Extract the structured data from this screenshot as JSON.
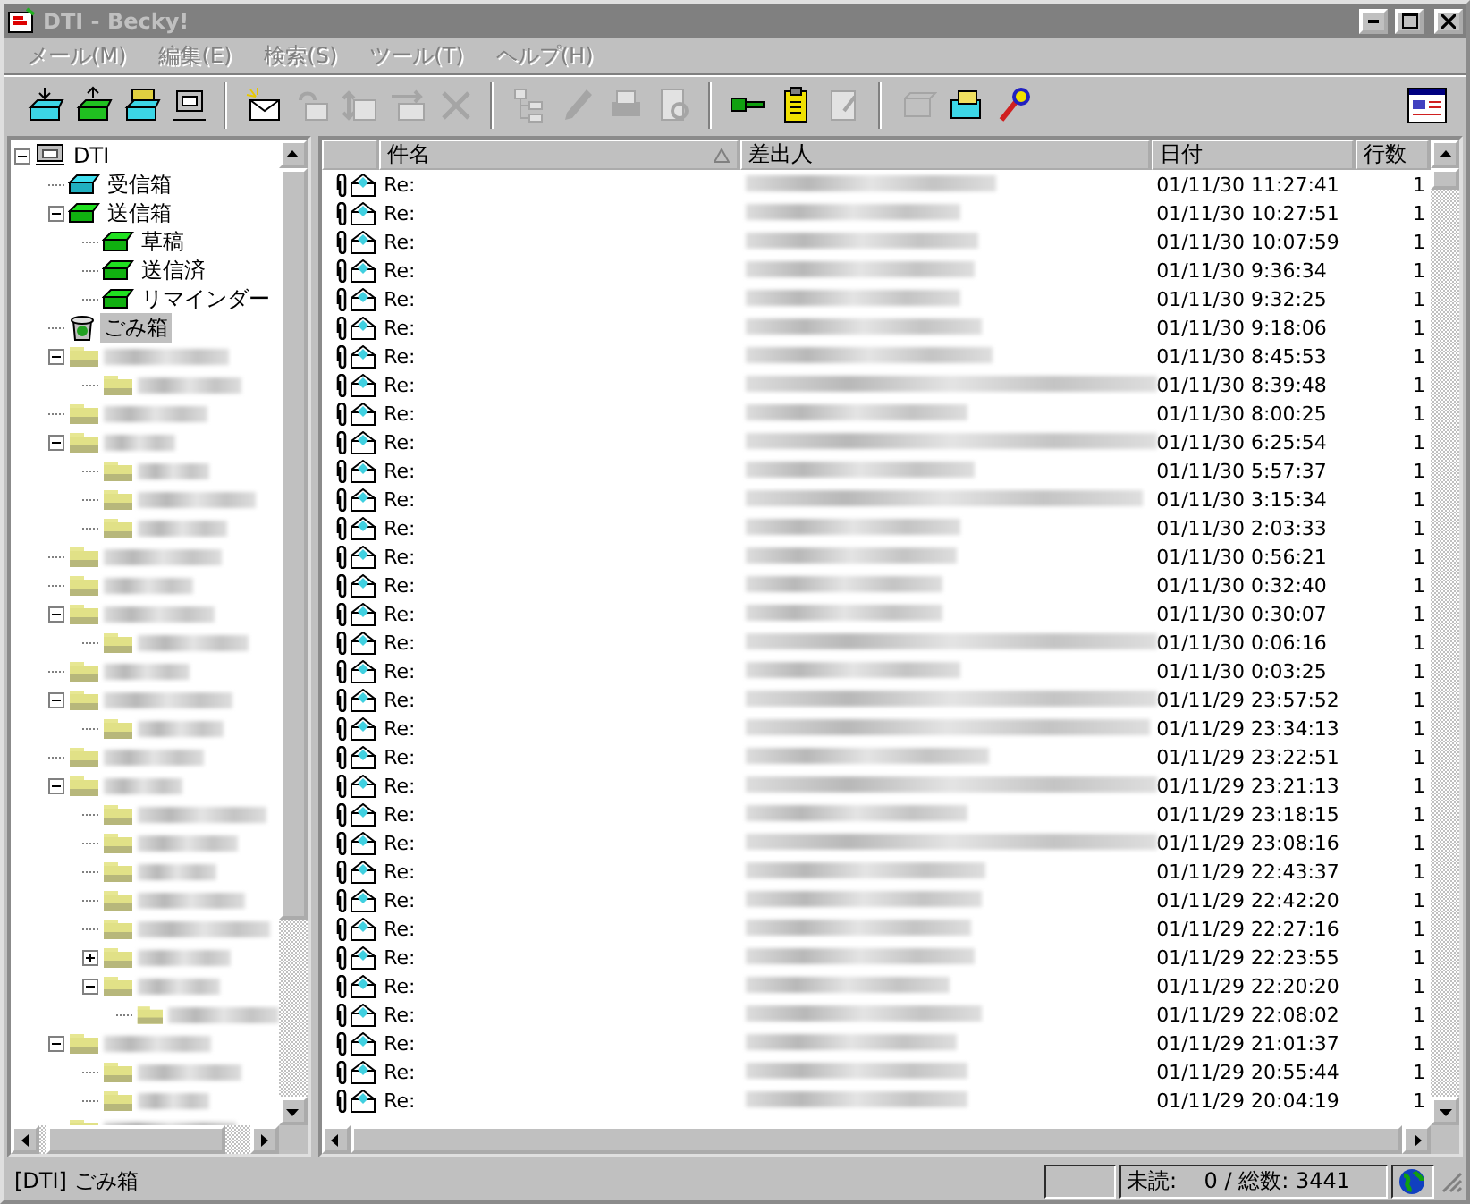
{
  "window": {
    "title": "DTI - Becky!"
  },
  "menu": [
    "メール(M)",
    "編集(E)",
    "検索(S)",
    "ツール(T)",
    "ヘルプ(H)"
  ],
  "toolbar": [
    {
      "kind": "receive",
      "disabled": false
    },
    {
      "kind": "send",
      "disabled": false
    },
    {
      "kind": "sendreceive",
      "disabled": false
    },
    {
      "kind": "terminal",
      "disabled": false
    },
    {
      "kind": "sep"
    },
    {
      "kind": "compose",
      "disabled": false
    },
    {
      "kind": "reply",
      "disabled": true
    },
    {
      "kind": "replyall",
      "disabled": true
    },
    {
      "kind": "forward",
      "disabled": true
    },
    {
      "kind": "delete",
      "disabled": true
    },
    {
      "kind": "sep"
    },
    {
      "kind": "tree",
      "disabled": true
    },
    {
      "kind": "edit",
      "disabled": true
    },
    {
      "kind": "print",
      "disabled": true
    },
    {
      "kind": "preview",
      "disabled": true
    },
    {
      "kind": "sep"
    },
    {
      "kind": "key",
      "disabled": false
    },
    {
      "kind": "clipboard",
      "disabled": false
    },
    {
      "kind": "notepad",
      "disabled": true
    },
    {
      "kind": "sep"
    },
    {
      "kind": "mailbox",
      "disabled": true
    },
    {
      "kind": "address",
      "disabled": false
    },
    {
      "kind": "wizard",
      "disabled": false
    }
  ],
  "tree": [
    {
      "kind": "server",
      "label": "DTI",
      "expanded": true,
      "selected": false,
      "children": [
        {
          "kind": "inbox",
          "label": "受信箱",
          "selected": false
        },
        {
          "kind": "outbox",
          "label": "送信箱",
          "expanded": true,
          "selected": false,
          "children": [
            {
              "kind": "box",
              "label": "草稿",
              "selected": false
            },
            {
              "kind": "box",
              "label": "送信済",
              "selected": false
            },
            {
              "kind": "box",
              "label": "リマインダー",
              "selected": false
            }
          ]
        },
        {
          "kind": "trash",
          "label": "ごみ箱",
          "selected": true
        },
        {
          "kind": "folder",
          "expanded": true,
          "children": [
            {
              "kind": "folder"
            }
          ]
        },
        {
          "kind": "folder"
        },
        {
          "kind": "folder",
          "expanded": true,
          "children": [
            {
              "kind": "folder"
            },
            {
              "kind": "folder"
            },
            {
              "kind": "folder"
            }
          ]
        },
        {
          "kind": "folder"
        },
        {
          "kind": "folder"
        },
        {
          "kind": "folder",
          "expanded": true,
          "children": [
            {
              "kind": "folder"
            }
          ]
        },
        {
          "kind": "folder"
        },
        {
          "kind": "folder",
          "expanded": true,
          "children": [
            {
              "kind": "folder"
            }
          ]
        },
        {
          "kind": "folder"
        },
        {
          "kind": "folder",
          "expanded": true,
          "children": [
            {
              "kind": "folder"
            },
            {
              "kind": "folder"
            },
            {
              "kind": "folder"
            },
            {
              "kind": "folder"
            },
            {
              "kind": "folder"
            },
            {
              "kind": "folder",
              "expanded": false
            },
            {
              "kind": "folder",
              "expanded": true,
              "children": [
                {
                  "kind": "folder"
                }
              ]
            }
          ]
        },
        {
          "kind": "folder",
          "expanded": true,
          "children": [
            {
              "kind": "folder"
            },
            {
              "kind": "folder"
            }
          ]
        },
        {
          "kind": "folder"
        }
      ]
    }
  ],
  "columns": [
    {
      "label": "件名",
      "sorted": true
    },
    {
      "label": "差出人",
      "sorted": false
    },
    {
      "label": "日付",
      "sorted": false
    },
    {
      "label": "行数",
      "sorted": false
    }
  ],
  "rows": [
    {
      "subject": "Re:",
      "date": "01/11/30 11:27:41",
      "lines": "1",
      "attachment": true,
      "read": true
    },
    {
      "subject": "Re:",
      "date": "01/11/30 10:27:51",
      "lines": "1",
      "attachment": true,
      "read": true
    },
    {
      "subject": "Re:",
      "date": "01/11/30 10:07:59",
      "lines": "1",
      "attachment": true,
      "read": true
    },
    {
      "subject": "Re:",
      "date": "01/11/30 9:36:34",
      "lines": "1",
      "attachment": true,
      "read": true
    },
    {
      "subject": "Re:",
      "date": "01/11/30 9:32:25",
      "lines": "1",
      "attachment": true,
      "read": true
    },
    {
      "subject": "Re:",
      "date": "01/11/30 9:18:06",
      "lines": "1",
      "attachment": true,
      "read": true
    },
    {
      "subject": "Re:",
      "date": "01/11/30 8:45:53",
      "lines": "1",
      "attachment": true,
      "read": true
    },
    {
      "subject": "Re:",
      "date": "01/11/30 8:39:48",
      "lines": "1",
      "attachment": true,
      "read": true
    },
    {
      "subject": "Re:",
      "date": "01/11/30 8:00:25",
      "lines": "1",
      "attachment": true,
      "read": true
    },
    {
      "subject": "Re:",
      "date": "01/11/30 6:25:54",
      "lines": "1",
      "attachment": true,
      "read": true
    },
    {
      "subject": "Re:",
      "date": "01/11/30 5:57:37",
      "lines": "1",
      "attachment": true,
      "read": true
    },
    {
      "subject": "Re:",
      "date": "01/11/30 3:15:34",
      "lines": "1",
      "attachment": true,
      "read": true
    },
    {
      "subject": "Re:",
      "date": "01/11/30 2:03:33",
      "lines": "1",
      "attachment": true,
      "read": true
    },
    {
      "subject": "Re:",
      "date": "01/11/30 0:56:21",
      "lines": "1",
      "attachment": true,
      "read": true
    },
    {
      "subject": "Re:",
      "date": "01/11/30 0:32:40",
      "lines": "1",
      "attachment": true,
      "read": true
    },
    {
      "subject": "Re:",
      "date": "01/11/30 0:30:07",
      "lines": "1",
      "attachment": true,
      "read": true
    },
    {
      "subject": "Re:",
      "date": "01/11/30 0:06:16",
      "lines": "1",
      "attachment": true,
      "read": true
    },
    {
      "subject": "Re:",
      "date": "01/11/30 0:03:25",
      "lines": "1",
      "attachment": true,
      "read": true
    },
    {
      "subject": "Re:",
      "date": "01/11/29 23:57:52",
      "lines": "1",
      "attachment": true,
      "read": true
    },
    {
      "subject": "Re:",
      "date": "01/11/29 23:34:13",
      "lines": "1",
      "attachment": true,
      "read": true
    },
    {
      "subject": "Re:",
      "date": "01/11/29 23:22:51",
      "lines": "1",
      "attachment": true,
      "read": true
    },
    {
      "subject": "Re:",
      "date": "01/11/29 23:21:13",
      "lines": "1",
      "attachment": true,
      "read": true
    },
    {
      "subject": "Re:",
      "date": "01/11/29 23:18:15",
      "lines": "1",
      "attachment": true,
      "read": true
    },
    {
      "subject": "Re:",
      "date": "01/11/29 23:08:16",
      "lines": "1",
      "attachment": true,
      "read": true
    },
    {
      "subject": "Re:",
      "date": "01/11/29 22:43:37",
      "lines": "1",
      "attachment": true,
      "read": true
    },
    {
      "subject": "Re:",
      "date": "01/11/29 22:42:20",
      "lines": "1",
      "attachment": true,
      "read": true
    },
    {
      "subject": "Re:",
      "date": "01/11/29 22:27:16",
      "lines": "1",
      "attachment": true,
      "read": true
    },
    {
      "subject": "Re:",
      "date": "01/11/29 22:23:55",
      "lines": "1",
      "attachment": true,
      "read": true
    },
    {
      "subject": "Re:",
      "date": "01/11/29 22:20:20",
      "lines": "1",
      "attachment": true,
      "read": true
    },
    {
      "subject": "Re:",
      "date": "01/11/29 22:08:02",
      "lines": "1",
      "attachment": true,
      "read": true
    },
    {
      "subject": "Re:",
      "date": "01/11/29 21:01:37",
      "lines": "1",
      "attachment": true,
      "read": true
    },
    {
      "subject": "Re:",
      "date": "01/11/29 20:55:44",
      "lines": "1",
      "attachment": true,
      "read": true
    },
    {
      "subject": "Re:",
      "date": "01/11/29 20:04:19",
      "lines": "1",
      "attachment": true,
      "read": true
    }
  ],
  "status_bar": {
    "folder": "[DTI] ごみ箱",
    "counts": "未読:    0 / 総数: 3441"
  }
}
